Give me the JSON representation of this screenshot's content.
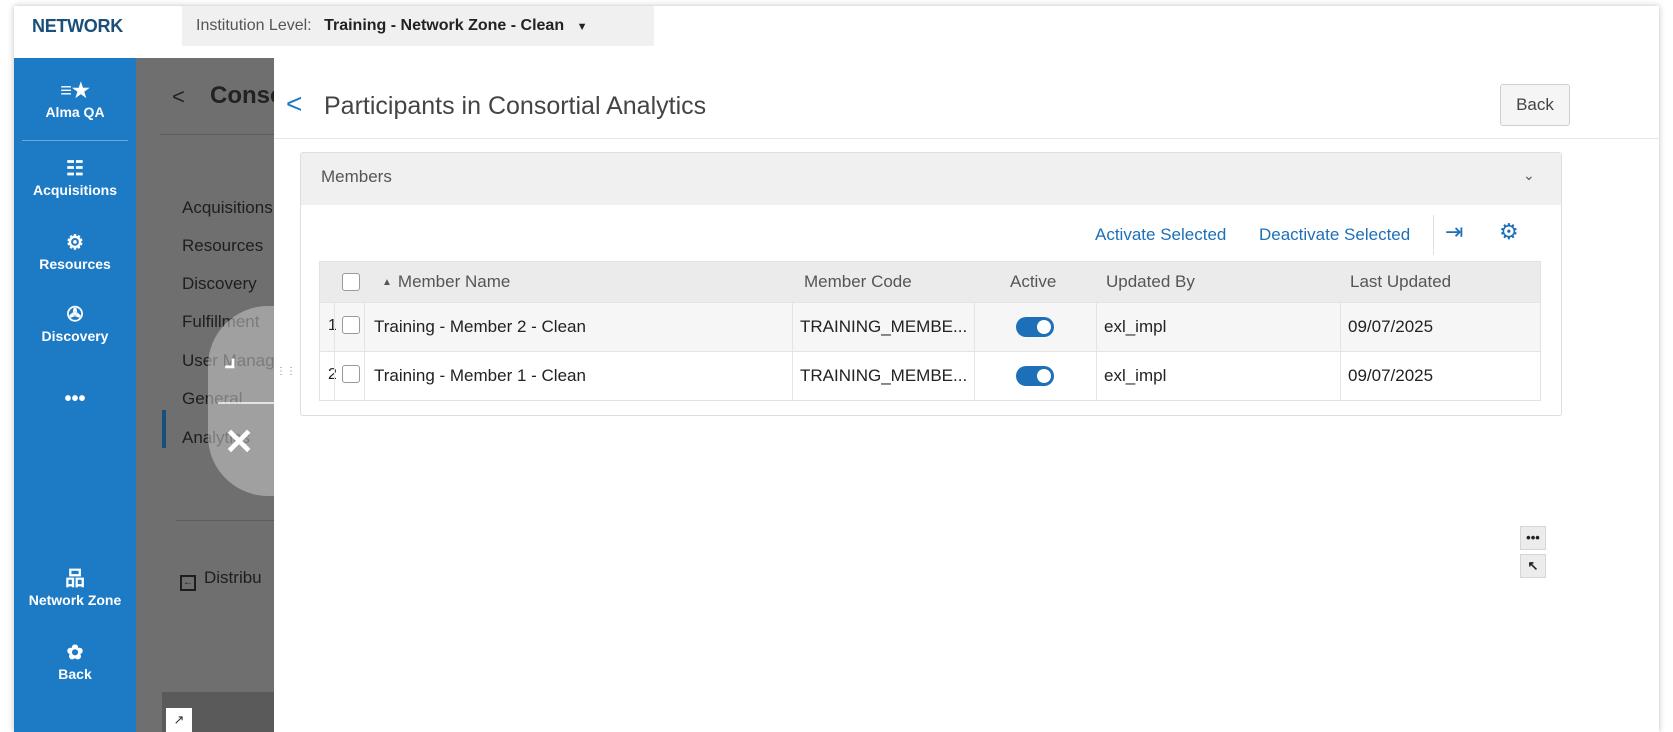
{
  "topbar": {
    "brand": "NETWORK",
    "institution_label": "Institution Level:",
    "institution_value": "Training - Network Zone - Clean",
    "institution_caret": "▼"
  },
  "leftnav": {
    "items": [
      {
        "label": "Alma QA",
        "icon": "star-list-icon",
        "glyph": "≡★"
      },
      {
        "label": "Acquisitions",
        "icon": "acquisitions-icon",
        "glyph": "☷"
      },
      {
        "label": "Resources",
        "icon": "resources-icon",
        "glyph": "⚙"
      },
      {
        "label": "Discovery",
        "icon": "discovery-icon",
        "glyph": "✇"
      },
      {
        "label": "",
        "icon": "more-icon",
        "glyph": "•••"
      },
      {
        "label": "Network Zone",
        "icon": "network-zone-icon",
        "glyph": "品"
      },
      {
        "label": "Back",
        "icon": "back-gear-icon",
        "glyph": "✿"
      }
    ]
  },
  "background_page": {
    "back_glyph": "<",
    "title": "Conso",
    "menu": [
      "Acquisitions",
      "Resources",
      "Discovery",
      "Fulfillment",
      "User Manag",
      "General",
      "Analytics"
    ],
    "distribution": "Distribu",
    "expand_glyph": "↗"
  },
  "floating": {
    "expand_glyph": "⌟",
    "close_glyph": "✕",
    "drag_glyph": "⋮⋮"
  },
  "panel": {
    "back_glyph": "<",
    "title": "Participants in Consortial Analytics",
    "back_button": "Back",
    "section": {
      "title": "Members",
      "collapse_glyph": "⌄",
      "actions": {
        "activate": "Activate Selected",
        "deactivate": "Deactivate Selected",
        "export_glyph": "⇥",
        "settings_glyph": "⚙"
      },
      "columns": {
        "name": "Member Name",
        "name_sort": "▲",
        "code": "Member Code",
        "active": "Active",
        "updated_by": "Updated By",
        "last_updated": "Last Updated"
      },
      "rows": [
        {
          "num": "1",
          "name": "Training - Member 2 - Clean",
          "code": "TRAINING_MEMBE...",
          "active": true,
          "updated_by": "exl_impl",
          "last_updated": "09/07/2025"
        },
        {
          "num": "2",
          "name": "Training - Member 1 - Clean",
          "code": "TRAINING_MEMBE...",
          "active": true,
          "updated_by": "exl_impl",
          "last_updated": "09/07/2025"
        }
      ]
    },
    "side_tools": {
      "more": "•••",
      "pointer": "↖"
    }
  },
  "colors": {
    "nav_blue": "#1d7ac5",
    "link_blue": "#1d6fb8",
    "brand_dark": "#1a4f7a"
  }
}
